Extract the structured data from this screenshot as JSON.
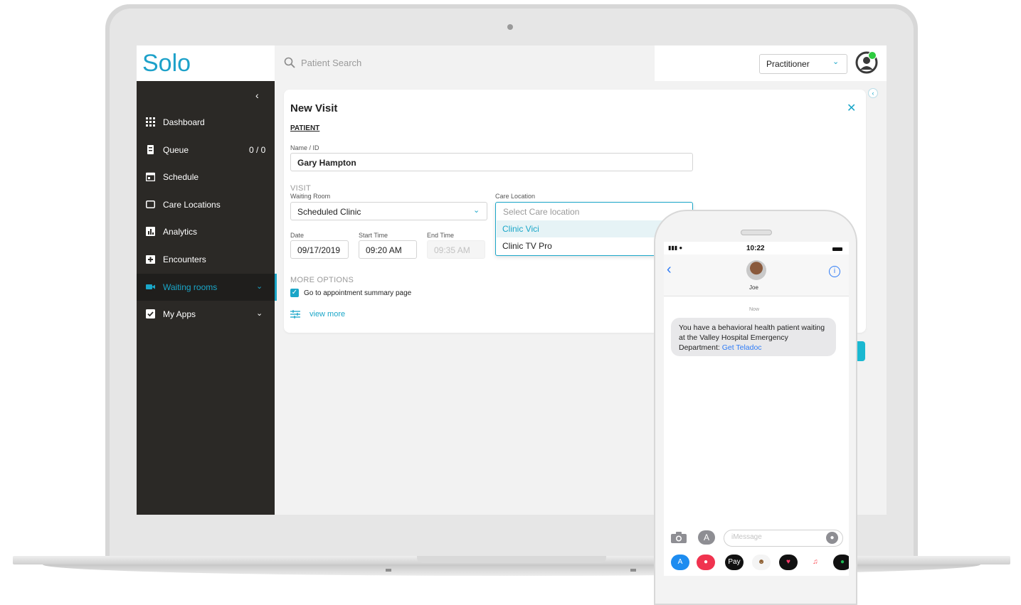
{
  "app": {
    "logo": "Solo",
    "search_placeholder": "Patient Search",
    "role_select": "Practitioner"
  },
  "sidebar": {
    "items": [
      {
        "label": "Dashboard",
        "icon": "grid-icon"
      },
      {
        "label": "Queue",
        "icon": "queue-icon",
        "count": "0 / 0"
      },
      {
        "label": "Schedule",
        "icon": "calendar-icon"
      },
      {
        "label": "Care Locations",
        "icon": "location-icon"
      },
      {
        "label": "Analytics",
        "icon": "analytics-icon"
      },
      {
        "label": "Encounters",
        "icon": "encounters-icon"
      },
      {
        "label": "Waiting rooms",
        "icon": "video-icon",
        "active": true
      },
      {
        "label": "My Apps",
        "icon": "check-square-icon"
      }
    ]
  },
  "visit_form": {
    "title": "New Visit",
    "patient_section": "PATIENT",
    "name_label": "Name / ID",
    "name_value": "Gary Hampton",
    "visit_section": "VISIT",
    "waiting_room_label": "Waiting Room",
    "waiting_room_value": "Scheduled Clinic",
    "care_location_label": "Care Location",
    "care_location_placeholder": "Select Care location",
    "care_location_options": [
      "Clinic Vici",
      "Clinic TV Pro"
    ],
    "date_label": "Date",
    "date_value": "09/17/2019",
    "start_label": "Start Time",
    "start_value": "09:20 AM",
    "end_label": "End Time",
    "end_value": "09:35 AM",
    "more_options_label": "MORE OPTIONS",
    "checkbox_label": "Go to appointment summary page",
    "checkbox_checked": true,
    "view_more": "view more"
  },
  "phone": {
    "time": "10:22",
    "contact": "Joe",
    "message_time": "Now",
    "message_text": "You have a behavioral health patient waiting at the Valley Hospital Emergency Department: ",
    "message_link": "Get Teladoc",
    "input_placeholder": "iMessage",
    "dock_labels": [
      "Pay"
    ]
  },
  "colors": {
    "accent": "#1aa6c8",
    "sidebar_bg": "#2b2926",
    "ios_blue": "#2f7cf6"
  }
}
